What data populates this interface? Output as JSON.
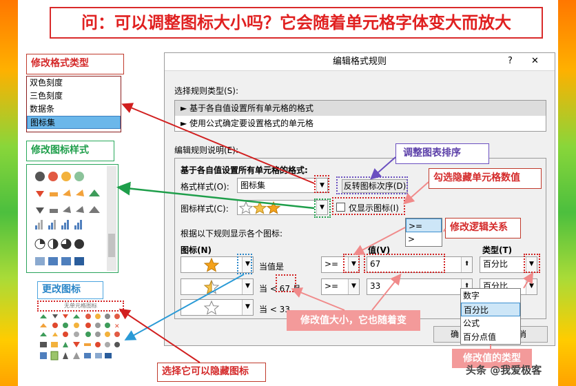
{
  "title": "问：可以调整图标大小吗？它会随着单元格字体变大而放大",
  "callouts": {
    "format_type": "修改格式类型",
    "icon_style": "修改图标样式",
    "change_icon": "更改图标",
    "sort_order": "调整图表排序",
    "hide_value": "勾选隐藏单元格数值",
    "logic": "修改逻辑关系",
    "value_change": "修改值大小，它也随着变",
    "hide_icon": "选择它可以隐藏图标",
    "value_type": "修改值的类型"
  },
  "format_types": [
    "双色刻度",
    "三色刻度",
    "数据条",
    "图标集"
  ],
  "icon_dropdown_header": "无单元格图标",
  "dialog": {
    "title": "编辑格式规则",
    "help": "?",
    "close": "✕",
    "select_rule_type_label": "选择规则类型(S):",
    "rule_types": [
      "► 基于各自值设置所有单元格的格式",
      "► 使用公式确定要设置格式的单元格"
    ],
    "edit_desc_label": "编辑规则说明(E):",
    "section_title": "基于各自值设置所有单元格的格式:",
    "format_style_label": "格式样式(O):",
    "format_style_value": "图标集",
    "reverse_button": "反转图标次序(D)",
    "icon_style_label": "图标样式(C):",
    "show_icon_only": "仅显示图标(I)",
    "rule_desc": "根据以下规则显示各个图标:",
    "col_icon": "图标(N)",
    "col_value": "值(V)",
    "col_type": "类型(T)",
    "rows": [
      {
        "cond": "当值是",
        "op": ">=",
        "value": "67",
        "type": "百分比"
      },
      {
        "cond": "当 < 67 且",
        "op": ">=",
        "value": "33",
        "type": "百分比"
      },
      {
        "cond": "当 < 33"
      }
    ],
    "ok": "确",
    "cancel": "消"
  },
  "logic_options": [
    ">=",
    ">"
  ],
  "type_options": [
    "数字",
    "百分比",
    "公式",
    "百分点值"
  ],
  "watermark": "头条 @我爱极客"
}
